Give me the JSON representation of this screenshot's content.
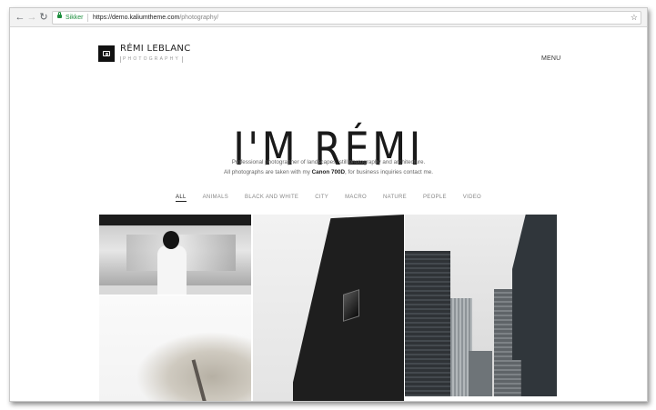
{
  "browser": {
    "back_icon": "arrow-left-icon",
    "forward_icon": "arrow-right-icon",
    "reload_icon": "reload-icon",
    "secure_label": "Sikker",
    "url_host": "https://demo.kaliumtheme.com",
    "url_path": "/photography/",
    "bookmark_icon": "star-icon"
  },
  "site": {
    "brand_name": "RÉMI LEBLANC",
    "brand_tagline": "PHOTOGRAPHY",
    "menu_label": "MENU",
    "hero_title": "I'M RÉMI",
    "intro_line1": "Professional photographer of landscapes, still photography and architecture.",
    "intro_line2_before": "All photographs are taken with my",
    "intro_camera": "Canon 700D",
    "intro_line2_after": ", for business inquiries contact me.",
    "filters": [
      "ALL",
      "ANIMALS",
      "BLACK AND WHITE",
      "CITY",
      "MACRO",
      "NATURE",
      "PEOPLE",
      "VIDEO"
    ],
    "active_filter": "ALL"
  },
  "colors": {
    "secure_green": "#1e8e3e",
    "text_dark": "#222222",
    "text_muted": "#888888"
  }
}
